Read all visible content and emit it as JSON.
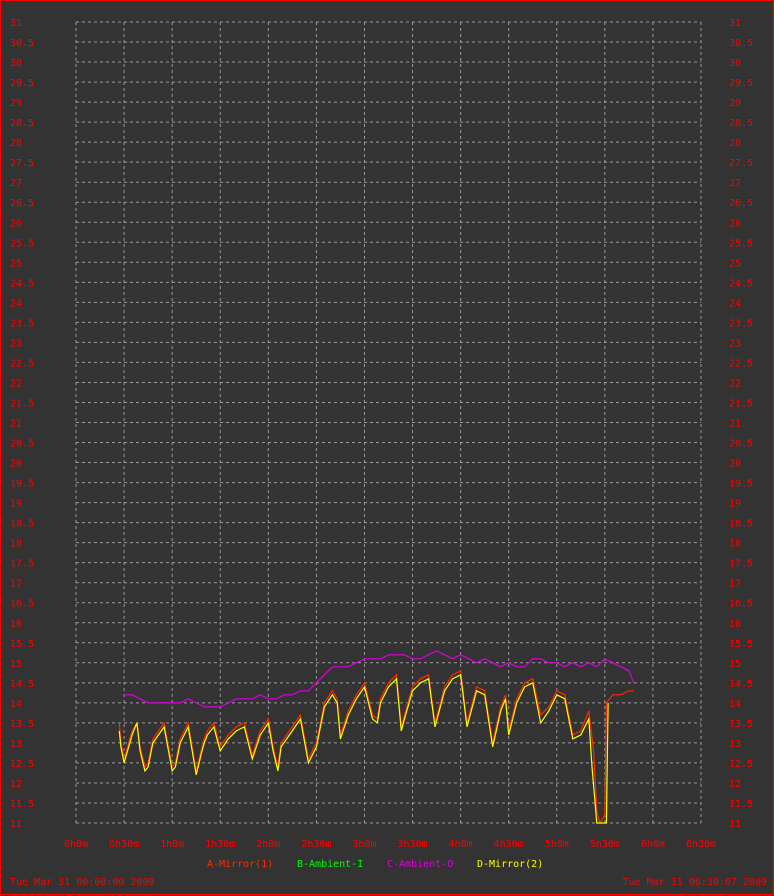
{
  "footer": {
    "start": "Tue Mar 31 00:00:00 2009",
    "end": "Tue Mar 31 06:30:07 2009"
  },
  "colors": {
    "background": "#333333",
    "frame": "#ff0000",
    "grid": "#9a9a9a",
    "labels": "#ff0000"
  },
  "chart_data": {
    "type": "line",
    "xlim_minutes": [
      0,
      390
    ],
    "ylim": [
      11,
      31
    ],
    "y_ticks": [
      "11",
      "11.5",
      "12",
      "12.5",
      "13",
      "13.5",
      "14",
      "14.5",
      "15",
      "15.5",
      "16",
      "16.5",
      "17",
      "17.5",
      "18",
      "18.5",
      "19",
      "19.5",
      "20",
      "20.5",
      "21",
      "21.5",
      "22",
      "22.5",
      "23",
      "23.5",
      "24",
      "24.5",
      "25",
      "25.5",
      "26",
      "26.5",
      "27",
      "27.5",
      "28",
      "28.5",
      "29",
      "29.5",
      "30",
      "30.5",
      "31"
    ],
    "x_ticks": [
      "0h0m",
      "0h30m",
      "1h0m",
      "1h30m",
      "2h0m",
      "2h30m",
      "3h0m",
      "3h30m",
      "4h0m",
      "4h30m",
      "5h0m",
      "5h30m",
      "6h0m",
      "6h30m"
    ],
    "grid": true,
    "legend_position": "bottom",
    "series": [
      {
        "name": "A-Mirror(1)",
        "color": "#ff2a00",
        "x": [
          27,
          28,
          30,
          35,
          38,
          40,
          43,
          45,
          48,
          55,
          60,
          62,
          65,
          70,
          75,
          78,
          80,
          82,
          86,
          90,
          95,
          100,
          105,
          110,
          115,
          120,
          123,
          126,
          128,
          135,
          140,
          145,
          150,
          153,
          155,
          160,
          163,
          165,
          170,
          175,
          180,
          185,
          188,
          190,
          195,
          200,
          203,
          205,
          210,
          215,
          220,
          224,
          226,
          230,
          235,
          240,
          244,
          246,
          250,
          255,
          260,
          265,
          268,
          270,
          275,
          280,
          285,
          290,
          295,
          300,
          305,
          310,
          315,
          320,
          323,
          325,
          327,
          330,
          331,
          335,
          340,
          345,
          348
        ],
        "y": [
          13.5,
          13.0,
          12.6,
          13.3,
          13.5,
          12.9,
          12.4,
          12.5,
          13.1,
          13.5,
          12.4,
          12.5,
          13.1,
          13.5,
          12.3,
          12.8,
          13.1,
          13.3,
          13.5,
          12.9,
          13.2,
          13.4,
          13.5,
          12.7,
          13.3,
          13.6,
          12.9,
          12.4,
          13.0,
          13.4,
          13.7,
          12.6,
          13.0,
          13.6,
          14.0,
          14.3,
          14.1,
          13.2,
          13.8,
          14.2,
          14.5,
          13.7,
          13.6,
          14.1,
          14.5,
          14.7,
          13.4,
          13.7,
          14.4,
          14.6,
          14.7,
          13.5,
          13.8,
          14.4,
          14.7,
          14.8,
          13.5,
          13.8,
          14.4,
          14.3,
          13.0,
          13.9,
          14.2,
          13.3,
          14.1,
          14.5,
          14.6,
          13.7,
          13.9,
          14.3,
          14.2,
          13.2,
          13.3,
          13.8,
          12.8,
          11.3,
          11.0,
          11.2,
          14.0,
          14.2,
          14.2,
          14.3,
          14.3
        ]
      },
      {
        "name": "B-Ambient-I",
        "color": "#00ff00",
        "x": [],
        "y": []
      },
      {
        "name": "C-Ambient-O",
        "color": "#dd00dd",
        "x": [
          30,
          35,
          40,
          45,
          50,
          55,
          60,
          65,
          70,
          75,
          80,
          85,
          90,
          95,
          100,
          105,
          110,
          115,
          120,
          125,
          130,
          135,
          140,
          145,
          150,
          155,
          160,
          165,
          170,
          175,
          180,
          185,
          190,
          195,
          200,
          205,
          210,
          215,
          220,
          225,
          230,
          235,
          240,
          245,
          250,
          255,
          260,
          265,
          270,
          275,
          280,
          285,
          290,
          295,
          300,
          305,
          310,
          315,
          320,
          325,
          330,
          335,
          340,
          345,
          348
        ],
        "y": [
          14.2,
          14.2,
          14.1,
          14.0,
          14.0,
          14.0,
          14.0,
          14.0,
          14.1,
          14.0,
          13.9,
          13.9,
          13.9,
          14.0,
          14.1,
          14.1,
          14.1,
          14.2,
          14.1,
          14.1,
          14.2,
          14.2,
          14.3,
          14.3,
          14.5,
          14.7,
          14.9,
          14.9,
          14.9,
          15.0,
          15.1,
          15.1,
          15.1,
          15.2,
          15.2,
          15.2,
          15.1,
          15.1,
          15.2,
          15.3,
          15.2,
          15.1,
          15.2,
          15.1,
          15.0,
          15.1,
          15.0,
          14.9,
          15.0,
          14.9,
          14.9,
          15.1,
          15.1,
          15.0,
          15.0,
          14.9,
          15.0,
          14.9,
          15.0,
          14.9,
          15.1,
          15.0,
          14.9,
          14.8,
          14.5
        ]
      },
      {
        "name": "D-Mirror(2)",
        "color": "#ffff00",
        "x": [
          27,
          28,
          30,
          35,
          38,
          40,
          43,
          45,
          48,
          55,
          60,
          62,
          65,
          70,
          75,
          78,
          80,
          82,
          86,
          90,
          95,
          100,
          105,
          110,
          115,
          120,
          123,
          126,
          128,
          135,
          140,
          145,
          150,
          153,
          155,
          160,
          163,
          165,
          170,
          175,
          180,
          185,
          188,
          190,
          195,
          200,
          203,
          205,
          210,
          215,
          220,
          224,
          226,
          230,
          235,
          240,
          244,
          246,
          250,
          255,
          260,
          265,
          268,
          270,
          275,
          280,
          285,
          290,
          295,
          300,
          305,
          310,
          315,
          320,
          322,
          325,
          326,
          327,
          329,
          330,
          331,
          332
        ],
        "y": [
          13.3,
          12.9,
          12.5,
          13.2,
          13.5,
          12.8,
          12.3,
          12.4,
          13.0,
          13.4,
          12.3,
          12.4,
          13.0,
          13.4,
          12.2,
          12.7,
          13.0,
          13.2,
          13.4,
          12.8,
          13.1,
          13.3,
          13.4,
          12.6,
          13.2,
          13.5,
          12.8,
          12.3,
          12.9,
          13.3,
          13.6,
          12.5,
          12.9,
          13.5,
          13.9,
          14.2,
          14.0,
          13.1,
          13.7,
          14.1,
          14.4,
          13.6,
          13.5,
          14.0,
          14.4,
          14.6,
          13.3,
          13.6,
          14.3,
          14.5,
          14.6,
          13.4,
          13.7,
          14.3,
          14.6,
          14.7,
          13.4,
          13.7,
          14.3,
          14.2,
          12.9,
          13.8,
          14.1,
          13.2,
          14.0,
          14.4,
          14.5,
          13.5,
          13.8,
          14.2,
          14.1,
          13.1,
          13.2,
          13.6,
          12.4,
          11.0,
          11.0,
          11.0,
          11.0,
          11.0,
          11.0,
          14.0
        ]
      }
    ]
  }
}
